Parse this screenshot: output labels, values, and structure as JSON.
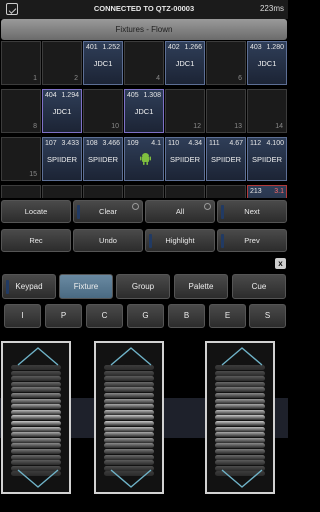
{
  "status": {
    "connection": "CONNECTED TO QTZ-00003",
    "latency": "223ms"
  },
  "window": {
    "title": "Fixtures - Flown"
  },
  "grid": {
    "empty": [
      {
        "num": "1"
      },
      {
        "num": "2"
      },
      {
        "num": "4"
      },
      {
        "num": "6"
      },
      {
        "num": "8"
      },
      {
        "num": "10"
      },
      {
        "num": "12"
      },
      {
        "num": "13"
      },
      {
        "num": "14"
      },
      {
        "num": "15"
      }
    ],
    "fixtures": [
      {
        "no": "401",
        "val": "1.252",
        "name": "JDC1"
      },
      {
        "no": "402",
        "val": "1.266",
        "name": "JDC1"
      },
      {
        "no": "403",
        "val": "1.280",
        "name": "JDC1"
      },
      {
        "no": "404",
        "val": "1.294",
        "name": "JDC1"
      },
      {
        "no": "405",
        "val": "1.308",
        "name": "JDC1"
      },
      {
        "no": "107",
        "val": "3.433",
        "name": "SPIIDER"
      },
      {
        "no": "108",
        "val": "3.466",
        "name": "SPIIDER"
      },
      {
        "no": "109",
        "val": "4.1",
        "name": ""
      },
      {
        "no": "110",
        "val": "4.34",
        "name": "SPIIDER"
      },
      {
        "no": "111",
        "val": "4.67",
        "name": "SPIIDER"
      },
      {
        "no": "112",
        "val": "4.100",
        "name": "SPIIDER"
      },
      {
        "no": "213",
        "val": "3.1",
        "name": ""
      }
    ]
  },
  "controls": {
    "locate": "Locate",
    "clear": "Clear",
    "all": "All",
    "next": "Next",
    "rec": "Rec",
    "undo": "Undo",
    "highlight": "Highlight",
    "prev": "Prev"
  },
  "close_label": "x",
  "tabs": [
    "Keypad",
    "Fixture",
    "Group",
    "Palette",
    "Cue"
  ],
  "attributes": [
    "I",
    "P",
    "C",
    "G",
    "B",
    "E",
    "S"
  ],
  "colors": {
    "fixture_cell": "#2f3e58",
    "active_tab": "#5a7a92",
    "indicator": "#213a63"
  }
}
